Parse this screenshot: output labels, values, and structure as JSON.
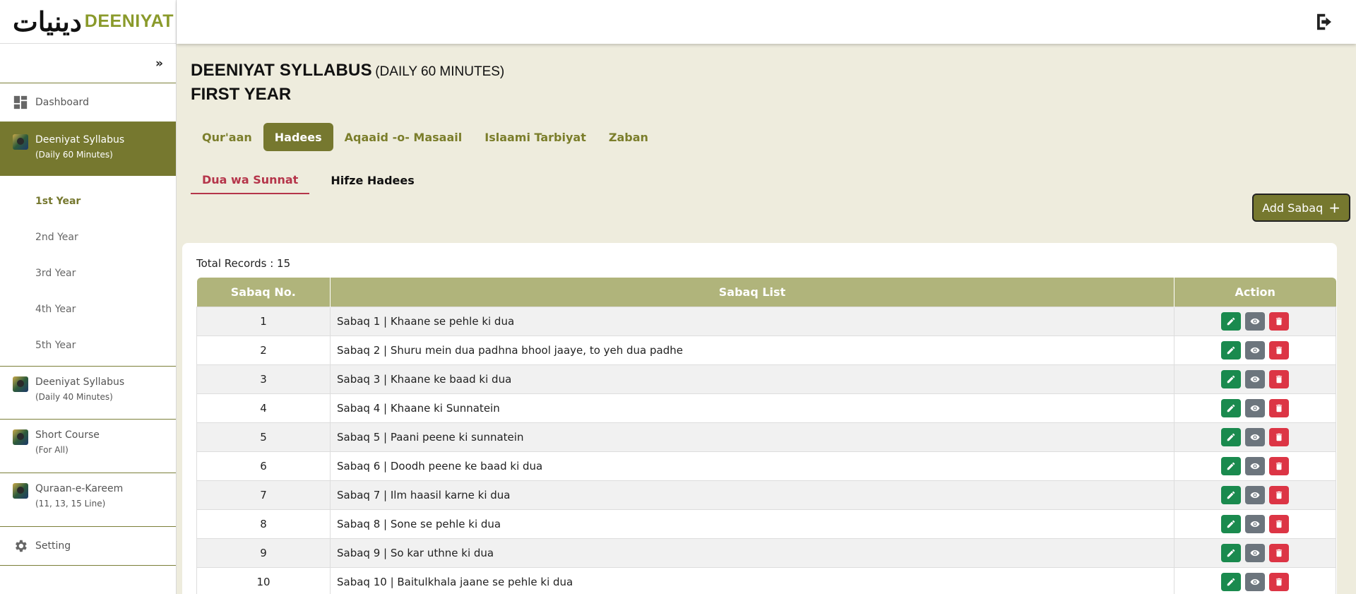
{
  "brand": {
    "urdu": "دینیات",
    "name": "DEENIYAT"
  },
  "sidebar": {
    "collapse": "»",
    "dashboard": "Dashboard",
    "active_group": {
      "title": "Deeniyat Syllabus",
      "subtitle": "(Daily 60 Minutes)"
    },
    "years": [
      "1st Year",
      "2nd Year",
      "3rd Year",
      "4th Year",
      "5th Year"
    ],
    "groups": [
      {
        "title": "Deeniyat Syllabus",
        "subtitle": "(Daily 40 Minutes)"
      },
      {
        "title": "Short Course",
        "subtitle": "(For All)"
      },
      {
        "title": "Quraan-e-Kareem",
        "subtitle": "(11, 13, 15 Line)"
      }
    ],
    "setting": "Setting"
  },
  "page": {
    "title": "DEENIYAT SYLLABUS",
    "title_paren": "(DAILY 60 MINUTES)",
    "year": "FIRST YEAR"
  },
  "tabs": [
    "Qur'aan",
    "Hadees",
    "Aqaaid -o- Masaail",
    "Islaami Tarbiyat",
    "Zaban"
  ],
  "subtabs": [
    "Dua wa Sunnat",
    "Hifze Hadees"
  ],
  "add_button": "Add Sabaq",
  "table": {
    "total_records": "Total Records : 15",
    "headers": [
      "Sabaq No.",
      "Sabaq List",
      "Action"
    ],
    "rows": [
      {
        "no": "1",
        "text": "Sabaq 1  |  Khaane se pehle ki dua"
      },
      {
        "no": "2",
        "text": "Sabaq 2  |  Shuru mein dua padhna bhool jaaye, to yeh dua padhe"
      },
      {
        "no": "3",
        "text": "Sabaq 3  |   Khaane ke baad ki dua"
      },
      {
        "no": "4",
        "text": "Sabaq 4  |  Khaane ki Sunnatein"
      },
      {
        "no": "5",
        "text": "Sabaq 5  |  Paani peene ki sunnatein"
      },
      {
        "no": "6",
        "text": "Sabaq 6  |  Doodh peene ke baad ki dua"
      },
      {
        "no": "7",
        "text": "Sabaq 7  |  Ilm haasil karne ki dua"
      },
      {
        "no": "8",
        "text": "Sabaq 8  |  Sone se pehle ki dua"
      },
      {
        "no": "9",
        "text": "Sabaq 9  |  So kar uthne ki dua"
      },
      {
        "no": "10",
        "text": "Sabaq 10  |  Baitulkhala jaane se pehle ki dua"
      }
    ]
  },
  "colors": {
    "olive": "#76782f",
    "olive_light": "#b0b47b",
    "bg": "#eeecdd",
    "red_active": "#b5354a",
    "edit": "#1a8a4e",
    "view": "#6c757d",
    "delete": "#dc3545"
  }
}
